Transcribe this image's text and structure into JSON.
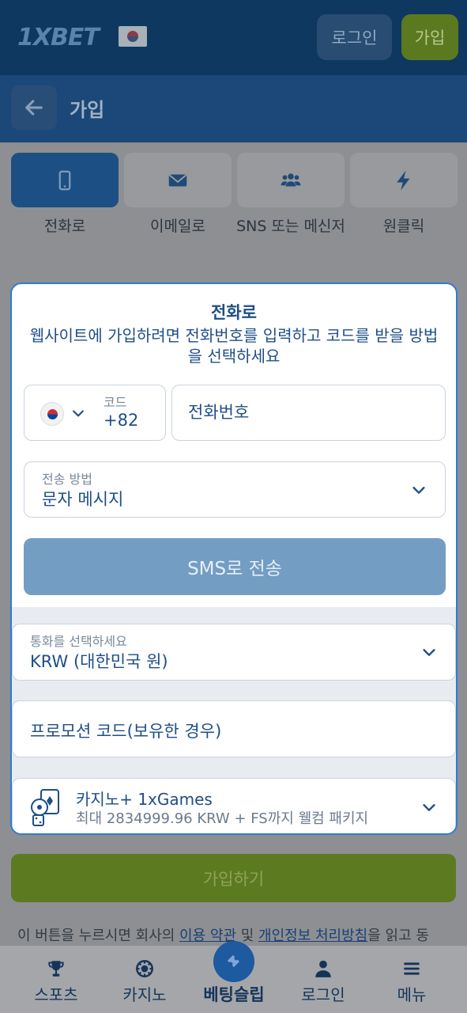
{
  "header": {
    "logo": "1XBET",
    "login_label": "로그인",
    "signup_label": "가입"
  },
  "subheader": {
    "title": "가입"
  },
  "tabs": [
    {
      "label": "전화로",
      "icon": "phone-icon",
      "active": true
    },
    {
      "label": "이메일로",
      "icon": "envelope-icon",
      "active": false
    },
    {
      "label": "SNS 또는 메신저",
      "icon": "users-icon",
      "active": false
    },
    {
      "label": "원클릭",
      "icon": "lightning-icon",
      "active": false
    }
  ],
  "modal": {
    "title": "전화로",
    "description": "웹사이트에 가입하려면 전화번호를 입력하고 코드를 받을 방법을 선택하세요",
    "code_label": "코드",
    "code_value": "+82",
    "phone_placeholder": "전화번호",
    "method_label": "전송 방법",
    "method_value": "문자 메시지",
    "sms_button": "SMS로 전송",
    "currency_label": "통화를 선택하세요",
    "currency_value": "KRW (대한민국 원)",
    "promo_placeholder": "프로모션 코드(보유한 경우)",
    "bonus_title": "카지노+ 1xGames",
    "bonus_subtitle": "최대 2834999.96 KRW + FS까지 웰컴 패키지"
  },
  "register_button": "가입하기",
  "terms": {
    "prefix": "이 버튼을 누르시면 회사의 ",
    "link1": "이용 약관",
    "middle": " 및 ",
    "link2": "개인정보 처리방침",
    "suffix": "을 읽고 동"
  },
  "bottom_nav": [
    {
      "label": "스포츠",
      "icon": "trophy-icon"
    },
    {
      "label": "카지노",
      "icon": "casino-chip-icon"
    },
    {
      "label": "베팅슬립",
      "icon": "ticket-icon"
    },
    {
      "label": "로그인",
      "icon": "user-icon"
    },
    {
      "label": "메뉴",
      "icon": "hamburger-icon"
    }
  ],
  "colors": {
    "header_bg": "#0e3860",
    "accent_blue": "#1c4f83",
    "accent_green": "#5b7a1f",
    "modal_border": "#2f7bd8"
  }
}
